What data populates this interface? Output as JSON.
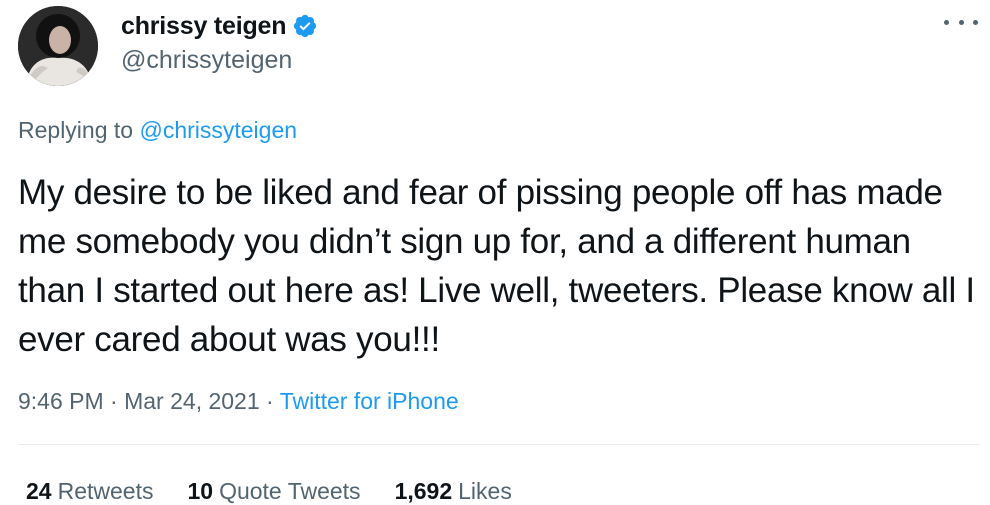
{
  "author": {
    "display_name": "chrissy teigen",
    "handle": "@chrissyteigen",
    "verified": true,
    "avatar_icon": "profile-photo-avatar"
  },
  "reply": {
    "prefix": "Replying to",
    "mention": "@chrissyteigen"
  },
  "tweet": {
    "text": "My desire to be liked and fear of pissing people off has made me somebody you didn’t sign up for, and a different human than I started out here as! Live well, tweeters. Please know all I ever cared about was you!!!"
  },
  "meta": {
    "time": "9:46 PM",
    "separator": "·",
    "date": "Mar 24, 2021",
    "source": "Twitter for iPhone"
  },
  "stats": {
    "retweets_count": "24",
    "retweets_label": "Retweets",
    "quotes_count": "10",
    "quotes_label": "Quote Tweets",
    "likes_count": "1,692",
    "likes_label": "Likes"
  },
  "colors": {
    "text_primary": "#0f1419",
    "text_secondary": "#536471",
    "accent": "#1d9bf0",
    "divider": "#e6ecf0"
  }
}
